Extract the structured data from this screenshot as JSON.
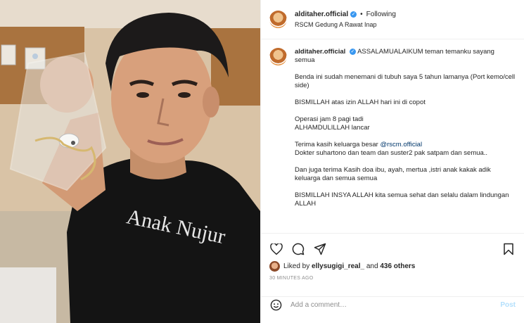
{
  "post": {
    "username": "alditaher.official",
    "follow_state": "Following",
    "location": "RSCM Gedung A Rawat Inap",
    "photo_shirt_text": "Anak Nujur"
  },
  "caption": {
    "username": "alditaher.official",
    "first_line": "ASSALAMUALAIKUM teman temanku sayang semua",
    "p1": "Benda ini sudah menemani di tubuh saya 5 tahun lamanya (Port kemo/cell side)",
    "p2": "BISMILLAH atas izin ALLAH hari ini di copot",
    "p3a": "Operasi jam 8 pagi tadi",
    "p3b": "ALHAMDULILLAH lancar",
    "p4a": "Terima kasih keluarga besar ",
    "p4_mention": "@rscm.official",
    "p4b": "Dokter suhartono dan team dan suster2 pak satpam dan semua..",
    "p5": "Dan juga terima Kasih doa ibu, ayah, mertua ,istri anak kakak adik keluarga dan semua semua",
    "p6": "BISMILLAH INSYA ALLAH kita semua sehat dan selalu dalam lindungan ALLAH"
  },
  "actions": {
    "liked_by_prefix": "Liked by ",
    "liked_by_user": "ellysugigi_real_",
    "liked_by_mid": " and ",
    "others_count": "436 others",
    "time_ago": "30 MINUTES AGO"
  },
  "comment": {
    "placeholder": "Add a comment…",
    "post_label": "Post"
  },
  "icons": {
    "verified": "verified-badge-icon",
    "heart": "heart-icon",
    "comment": "comment-icon",
    "share": "share-icon",
    "save": "bookmark-icon",
    "emoji": "emoji-icon"
  },
  "colors": {
    "verified": "#3897f0",
    "mention": "#00376b",
    "post_disabled": "#b2dffc",
    "muted": "#8e8e8e"
  }
}
